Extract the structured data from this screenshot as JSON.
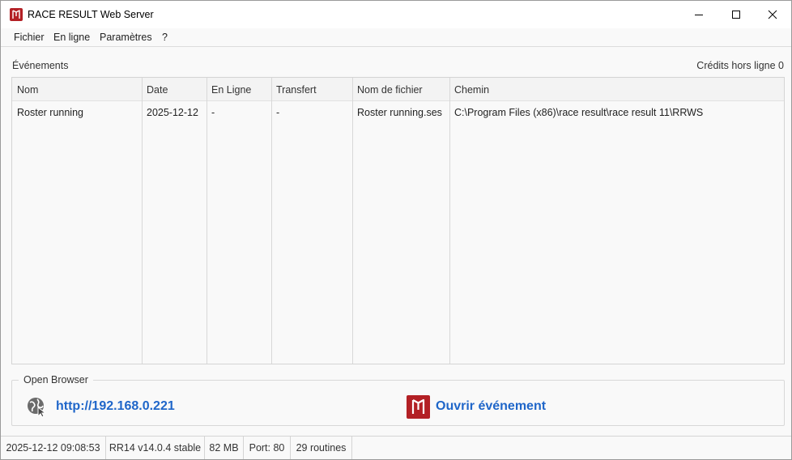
{
  "window": {
    "title": "RACE RESULT Web Server",
    "controls": {
      "minimize": "minimize-icon",
      "maximize": "maximize-icon",
      "close": "close-icon"
    }
  },
  "menu": {
    "items": [
      "Fichier",
      "En ligne",
      "Paramètres",
      "?"
    ]
  },
  "events_section": {
    "label": "Événements",
    "credits": "Crédits hors ligne 0"
  },
  "table": {
    "columns": [
      "Nom",
      "Date",
      "En Ligne",
      "Transfert",
      "Nom de fichier",
      "Chemin"
    ],
    "rows": [
      [
        "Roster running",
        "2025-12-12",
        "-",
        "-",
        "Roster running.ses",
        "C:\\Program Files (x86)\\race result\\race result 11\\RRWS"
      ]
    ]
  },
  "open_browser": {
    "title": "Open Browser",
    "url": "http://192.168.0.221",
    "open_event": "Ouvrir événement"
  },
  "statusbar": {
    "datetime": "2025-12-12 09:08:53",
    "version": "RR14 v14.0.4 stable",
    "memory": "82 MB",
    "port": "Port: 80",
    "routines": "29 routines"
  },
  "colors": {
    "brand": "#b32025",
    "link": "#1f66c9",
    "window_bg": "#f9f9f9"
  }
}
